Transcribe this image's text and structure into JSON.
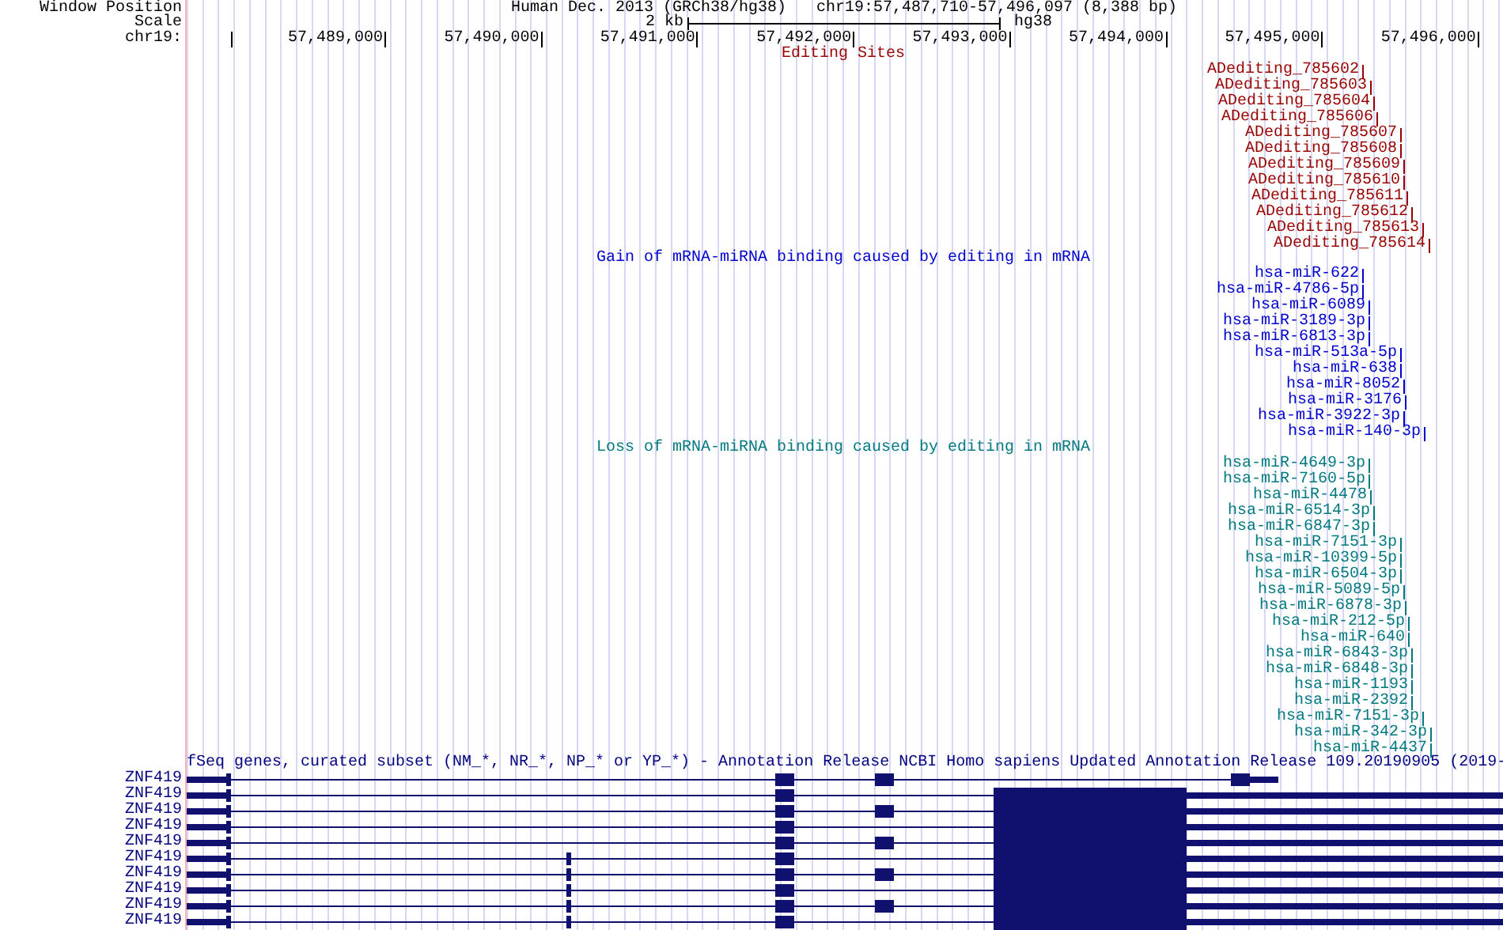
{
  "header": {
    "window_position_label": "Window Position",
    "assembly": "Human Dec. 2013 (GRCh38/hg38)",
    "position": "chr19:57,487,710-57,496,097 (8,388 bp)",
    "scale_label": "Scale",
    "scale_size": "2 kb",
    "scale_db": "hg38",
    "chrom_label": "chr19:",
    "ticks": [
      "57,489,000",
      "57,490,000",
      "57,491,000",
      "57,492,000",
      "57,493,000",
      "57,494,000",
      "57,495,000",
      "57,496,000"
    ]
  },
  "editing_track": {
    "title": "Editing Sites",
    "items": [
      "ADediting_785602",
      "ADediting_785603",
      "ADediting_785604",
      "ADediting_785606",
      "ADediting_785607",
      "ADediting_785608",
      "ADediting_785609",
      "ADediting_785610",
      "ADediting_785611",
      "ADediting_785612",
      "ADediting_785613",
      "ADediting_785614"
    ]
  },
  "gain_track": {
    "title": "Gain of mRNA-miRNA binding caused by editing in mRNA",
    "items": [
      "hsa-miR-622",
      "hsa-miR-4786-5p",
      "hsa-miR-6089",
      "hsa-miR-3189-3p",
      "hsa-miR-6813-3p",
      "hsa-miR-513a-5p",
      "hsa-miR-638",
      "hsa-miR-8052",
      "hsa-miR-3176",
      "hsa-miR-3922-3p",
      "hsa-miR-140-3p"
    ]
  },
  "loss_track": {
    "title": "Loss of mRNA-miRNA binding caused by editing in mRNA",
    "items": [
      "hsa-miR-4649-3p",
      "hsa-miR-7160-5p",
      "hsa-miR-4478",
      "hsa-miR-6514-3p",
      "hsa-miR-6847-3p",
      "hsa-miR-7151-3p",
      "hsa-miR-10399-5p",
      "hsa-miR-6504-3p",
      "hsa-miR-5089-5p",
      "hsa-miR-6878-3p",
      "hsa-miR-212-5p",
      "hsa-miR-640",
      "hsa-miR-6843-3p",
      "hsa-miR-6848-3p",
      "hsa-miR-1193",
      "hsa-miR-2392",
      "hsa-miR-7151-3p",
      "hsa-miR-342-3p",
      "hsa-miR-4437"
    ]
  },
  "gene_track": {
    "title": "fSeq genes, curated subset (NM_*, NR_*, NP_* or YP_*) - Annotation Release NCBI Homo sapiens Updated Annotation Release 109.20190905 (2019-",
    "rows": [
      "ZNF419",
      "ZNF419",
      "ZNF419",
      "ZNF419",
      "ZNF419",
      "ZNF419",
      "ZNF419",
      "ZNF419",
      "ZNF419",
      "ZNF419"
    ]
  }
}
